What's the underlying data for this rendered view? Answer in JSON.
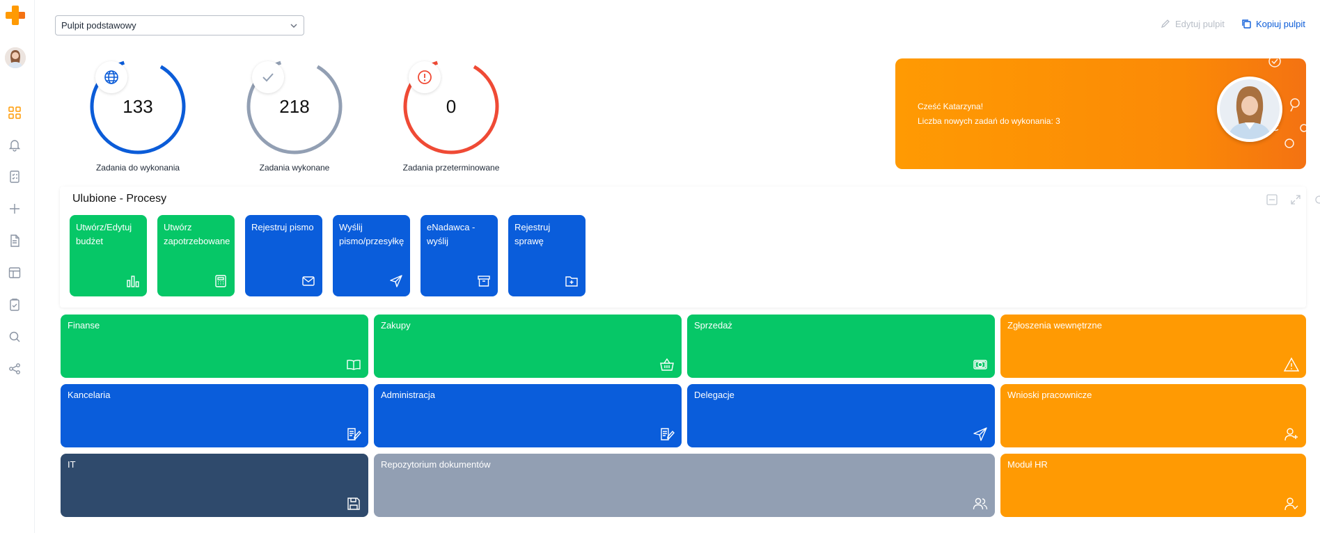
{
  "nav": {
    "logo": "plus-logo",
    "items": [
      "grid-icon",
      "bell-icon",
      "checklist-doc-icon",
      "plus-icon",
      "document-icon",
      "layout-icon",
      "clipboard-check-icon",
      "search-icon",
      "share-icon"
    ],
    "accent": "#ff9a03"
  },
  "header": {
    "dashboard_select": "Pulpit podstawowy",
    "edit_label": "Edytuj pulpit",
    "copy_label": "Kopiuj pulpit"
  },
  "stats": [
    {
      "value": "133",
      "label": "Zadania do wykonania",
      "icon": "globe-icon",
      "color": "#0b5cd8",
      "fraction": 1.0
    },
    {
      "value": "218",
      "label": "Zadania wykonane",
      "icon": "check-icon",
      "color": "#929fb3",
      "fraction": 1.0
    },
    {
      "value": "0",
      "label": "Zadania przeterminowane",
      "icon": "alert-circle-icon",
      "color": "#ef4a35",
      "fraction": 1.0
    }
  ],
  "banner": {
    "greeting": "Cześć Katarzyna!",
    "tasks_line": "Liczba nowych zadań do wykonania: 3",
    "colors": [
      "#ff9a03",
      "#f47212"
    ]
  },
  "favorites": {
    "title": "Ulubione - Procesy",
    "tiles": [
      {
        "label": "Utwórz/Edytuj budżet",
        "color": "green",
        "icon": "bar-chart-icon"
      },
      {
        "label": "Utwórz zapotrzebowane",
        "color": "green",
        "icon": "calculator-icon"
      },
      {
        "label": "Rejestruj pismo",
        "color": "blue",
        "icon": "mail-icon"
      },
      {
        "label": "Wyślij pismo/przesyłkę",
        "color": "blue",
        "icon": "send-icon"
      },
      {
        "label": "eNadawca - wyślij",
        "color": "blue",
        "icon": "archive-icon"
      },
      {
        "label": "Rejestruj sprawę",
        "color": "blue",
        "icon": "folder-plus-icon"
      }
    ]
  },
  "categories": [
    {
      "label": "Finanse",
      "color": "green",
      "icon": "book-icon"
    },
    {
      "label": "Zakupy",
      "color": "green",
      "icon": "basket-icon"
    },
    {
      "label": "Sprzedaż",
      "color": "green",
      "icon": "banknote-icon"
    },
    {
      "label": "Zgłoszenia wewnętrzne",
      "color": "orange",
      "icon": "warning-icon"
    },
    {
      "label": "Kancelaria",
      "color": "blue",
      "icon": "edit-document-icon"
    },
    {
      "label": "Administracja",
      "color": "blue",
      "icon": "edit-document-icon"
    },
    {
      "label": "Delegacje",
      "color": "blue",
      "icon": "send-icon"
    },
    {
      "label": "Wnioski pracownicze",
      "color": "orange",
      "icon": "user-plus-icon"
    },
    {
      "label": "IT",
      "color": "navy",
      "icon": "floppy-icon"
    },
    {
      "label": "Repozytorium dokumentów",
      "color": "grey",
      "icon": "users-icon"
    },
    {
      "label": "Moduł HR",
      "color": "orange",
      "icon": "user-check-icon"
    }
  ]
}
